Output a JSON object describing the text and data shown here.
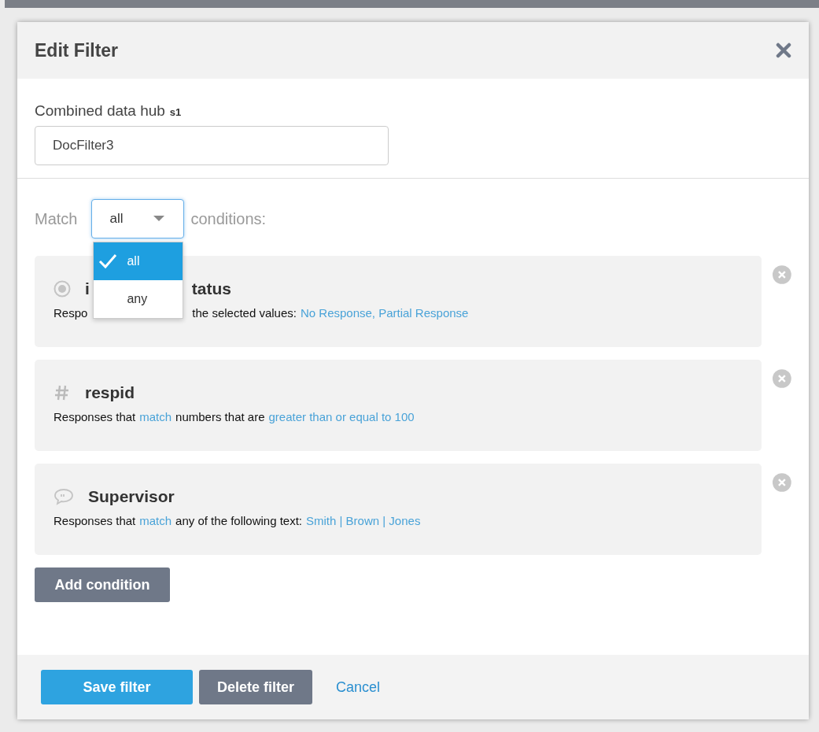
{
  "dialog": {
    "title": "Edit Filter"
  },
  "name_field": {
    "label": "Combined data hub",
    "tag": "s1",
    "value": "DocFilter3"
  },
  "match": {
    "prefix": "Match",
    "value": "all",
    "suffix": "conditions:",
    "expanded": true,
    "options": [
      {
        "label": "all",
        "selected": true
      },
      {
        "label": "any",
        "selected": false
      }
    ]
  },
  "conditions": [
    {
      "kind": "choice",
      "covered": true,
      "title": [
        "i",
        "tatus"
      ],
      "description": [
        [
          {
            "text": "Respo",
            "link": false
          }
        ],
        [
          {
            "text": "the selected values:",
            "link": false
          },
          {
            "text": "No Response, Partial Response",
            "link": true
          }
        ]
      ]
    },
    {
      "kind": "number",
      "title": [
        "respid"
      ],
      "description": [
        [
          {
            "text": "Responses that",
            "link": false
          },
          {
            "text": "match",
            "link": true
          },
          {
            "text": "numbers that are",
            "link": false
          },
          {
            "text": "greater than or equal to 100",
            "link": true
          }
        ]
      ]
    },
    {
      "kind": "text",
      "title": [
        "Supervisor"
      ],
      "description": [
        [
          {
            "text": "Responses that",
            "link": false
          },
          {
            "text": "match",
            "link": true
          },
          {
            "text": "any of the following text:",
            "link": false
          },
          {
            "text": "Smith | Brown | Jones",
            "link": true
          }
        ]
      ]
    }
  ],
  "add_button": "Add condition",
  "footer": [
    {
      "label": "Save filter",
      "kind": "primary"
    },
    {
      "label": "Delete filter",
      "kind": "secondary"
    },
    {
      "label": "Cancel",
      "kind": "link"
    }
  ]
}
